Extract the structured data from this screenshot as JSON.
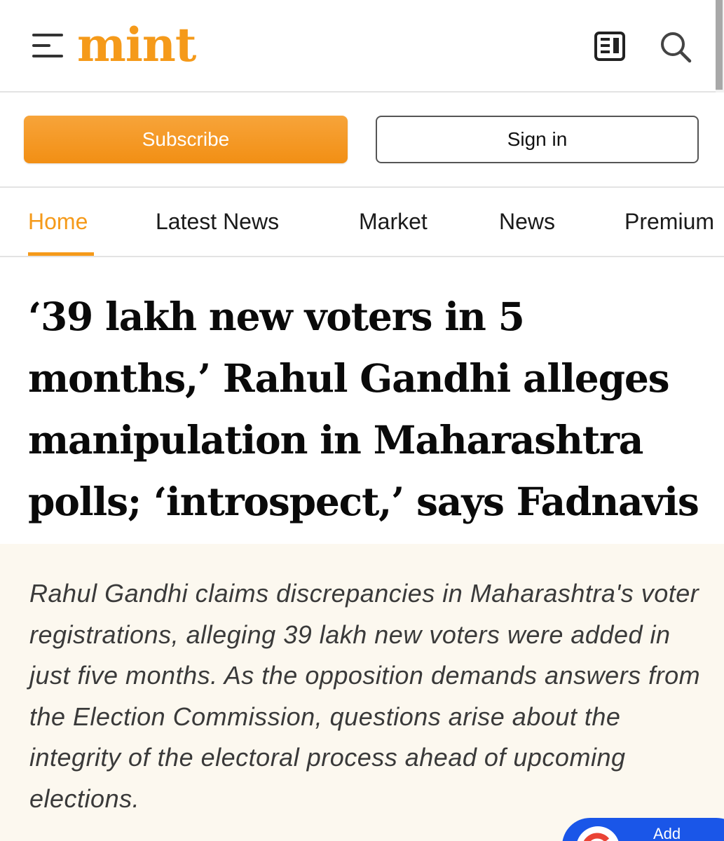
{
  "header": {
    "logo": "mint",
    "menu_icon": "hamburger-menu-icon",
    "epaper_icon": "newspaper-icon",
    "search_icon": "search-icon"
  },
  "auth": {
    "subscribe_label": "Subscribe",
    "signin_label": "Sign in"
  },
  "nav": {
    "items": [
      {
        "label": "Home",
        "active": true
      },
      {
        "label": "Latest News",
        "active": false
      },
      {
        "label": "Market",
        "active": false
      },
      {
        "label": "News",
        "active": false
      },
      {
        "label": "Premium",
        "active": false
      }
    ]
  },
  "article": {
    "headline": "‘39 lakh new voters in 5 months,’ Rahul Gandhi alleges manipulation in Maharashtra polls; ‘introspect,’ says Fadnavis",
    "summary": "Rahul Gandhi claims discrepancies in Maharashtra's voter registrations, alleging 39 lakh new voters were added in just five months. As the opposition demands answers from the Election Commission, questions arise about the integrity of the electoral process ahead of upcoming elections."
  },
  "widget": {
    "label": "Add"
  },
  "colors": {
    "brand": "#f59a1a",
    "summary_bg": "#fcf8ef",
    "widget_bg": "#1a56e8"
  }
}
